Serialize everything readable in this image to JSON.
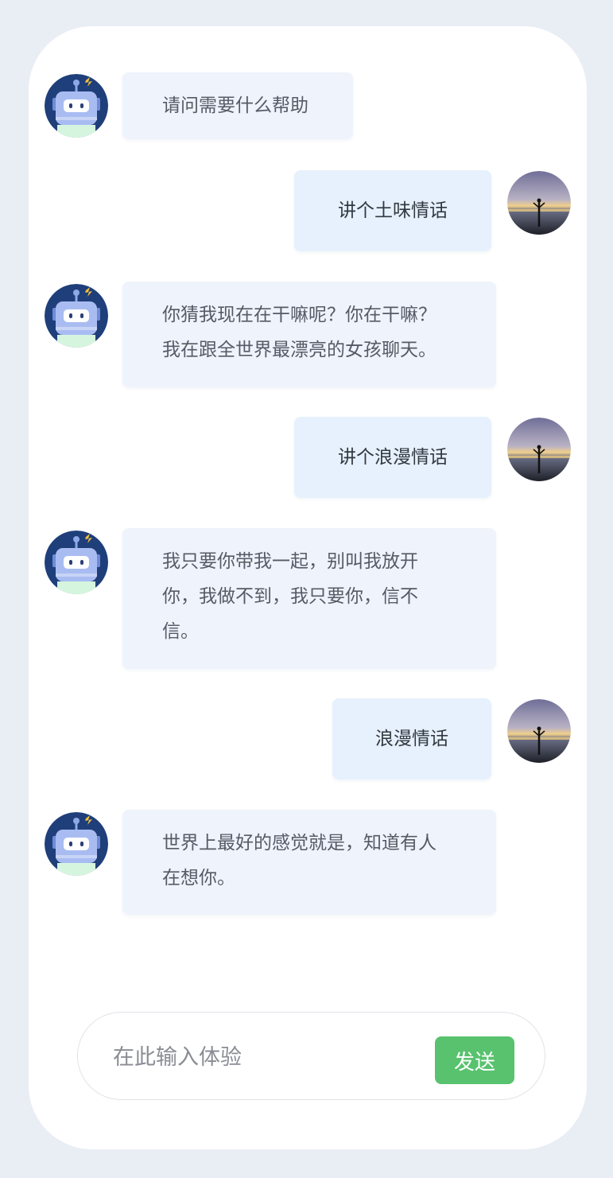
{
  "chat": {
    "messages": [
      {
        "sender": "bot",
        "lines": [
          "请问需要什么帮助"
        ]
      },
      {
        "sender": "user",
        "lines": [
          "讲个土味情话"
        ]
      },
      {
        "sender": "bot",
        "lines": [
          "你猜我现在在干嘛呢？你在干嘛？",
          "我在跟全世界最漂亮的女孩聊天。"
        ]
      },
      {
        "sender": "user",
        "lines": [
          "讲个浪漫情话"
        ]
      },
      {
        "sender": "bot",
        "lines": [
          "我只要你带我一起，别叫我放开",
          "你，我做不到，我只要你，信不",
          "信。"
        ]
      },
      {
        "sender": "user",
        "lines": [
          "浪漫情话"
        ]
      },
      {
        "sender": "bot",
        "lines": [
          "世界上最好的感觉就是，知道有人",
          "在想你。"
        ]
      }
    ]
  },
  "input": {
    "placeholder": "在此输入体验",
    "value": "",
    "send_label": "发送"
  },
  "icons": {
    "bot_avatar": "robot-avatar-icon",
    "user_avatar": "beach-sunset-avatar"
  },
  "colors": {
    "bot_bubble": "#eff3fb",
    "user_bubble": "#e6f1fd",
    "send_button": "#58c26e",
    "frame": "#e9edf4"
  }
}
